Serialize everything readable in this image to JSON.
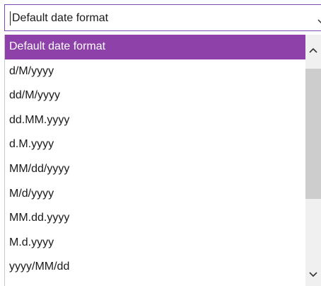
{
  "select": {
    "value": "Default date format",
    "chevron_icon": "chevron-down-icon"
  },
  "dropdown": {
    "selected_index": 0,
    "options": [
      "Default date format",
      "d/M/yyyy",
      "dd/M/yyyy",
      "dd.MM.yyyy",
      "d.M.yyyy",
      "MM/dd/yyyy",
      "M/d/yyyy",
      "MM.dd.yyyy",
      "M.d.yyyy",
      "yyyy/MM/dd"
    ],
    "scroll_up_icon": "chevron-up-icon",
    "scroll_down_icon": "chevron-down-icon"
  },
  "colors": {
    "accent": "#8e41a8",
    "field_border": "#7d4bb3",
    "scroll_track": "#f0f0f0",
    "scroll_thumb": "#cdcdcd"
  }
}
